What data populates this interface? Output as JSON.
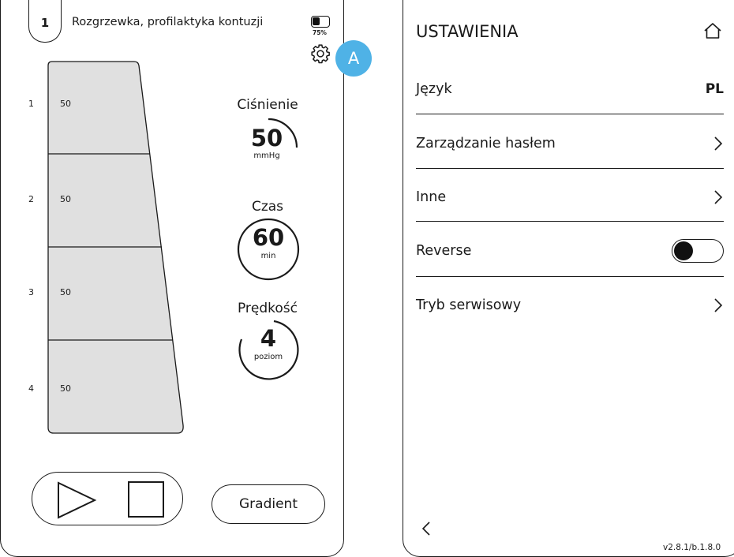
{
  "program": {
    "number": "1",
    "title": "Rozgrzewka, profilaktyka kontuzji",
    "battery_percent": "75%",
    "battery_level": 0.75,
    "avatar_initial": "A",
    "avatar_color": "#4fb2e6"
  },
  "sections": [
    {
      "index": "1",
      "value": "50"
    },
    {
      "index": "2",
      "value": "50"
    },
    {
      "index": "3",
      "value": "50"
    },
    {
      "index": "4",
      "value": "50"
    }
  ],
  "gauges": {
    "pressure": {
      "label": "Ciśnienie",
      "value": "50",
      "unit": "mmHg"
    },
    "time": {
      "label": "Czas",
      "value": "60",
      "unit": "min"
    },
    "speed": {
      "label": "Prędkość",
      "value": "4",
      "unit": "poziom"
    }
  },
  "controls": {
    "play_icon": "play-icon",
    "stop_icon": "stop-icon",
    "gradient_label": "Gradient"
  },
  "settings": {
    "title": "USTAWIENIA",
    "items": [
      {
        "label": "Język",
        "value": "PL"
      },
      {
        "label": "Zarządzanie hasłem",
        "icon": "chevron-right-icon"
      },
      {
        "label": "Inne",
        "icon": "chevron-right-icon"
      },
      {
        "label": "Reverse",
        "toggle_on": false
      },
      {
        "label": "Tryb serwisowy",
        "icon": "chevron-right-icon"
      }
    ],
    "version": "v2.8.1/b.1.8.0"
  }
}
